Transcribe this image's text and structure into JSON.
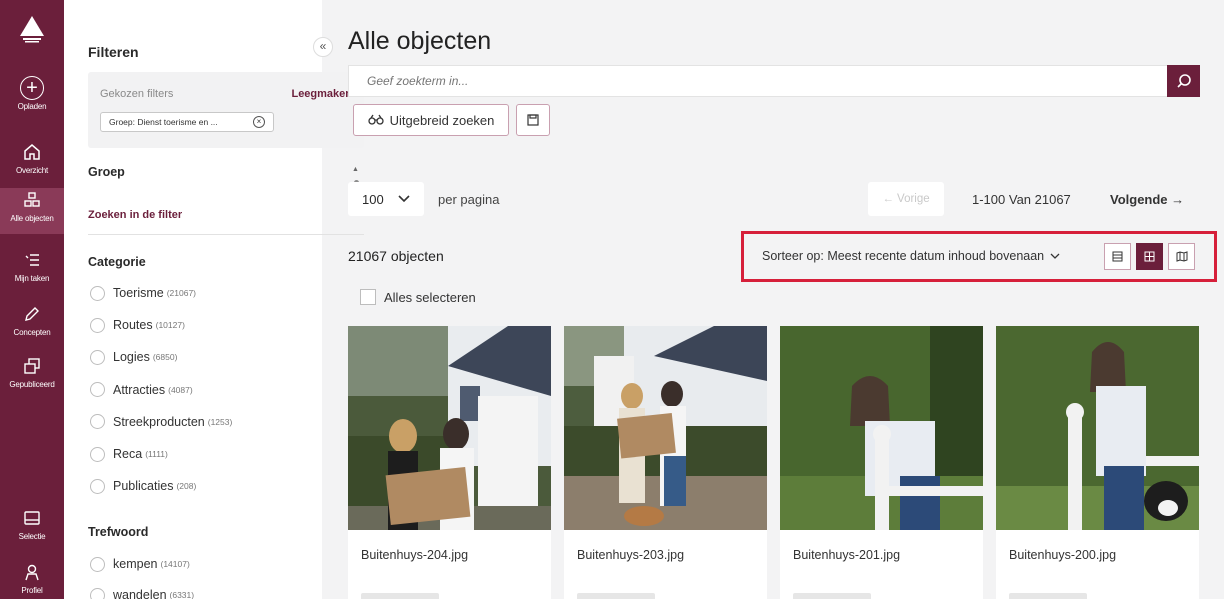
{
  "rail": {
    "items": [
      {
        "label": "Opladen",
        "icon": "plus-circle-icon"
      },
      {
        "label": "Overzicht",
        "icon": "home-icon"
      },
      {
        "label": "Alle objecten",
        "icon": "grid-icon"
      },
      {
        "label": "Mijn taken",
        "icon": "checklist-icon"
      },
      {
        "label": "Concepten",
        "icon": "pencil-icon"
      },
      {
        "label": "Gepubliceerd",
        "icon": "publish-icon"
      },
      {
        "label": "Selectie",
        "icon": "tray-icon"
      },
      {
        "label": "Profiel",
        "icon": "user-icon"
      }
    ]
  },
  "filters": {
    "title": "Filteren",
    "chosen_label": "Gekozen filters",
    "clear_label": "Leegmaken",
    "chip": "Groep: Dienst toerisme en ...",
    "groep_title": "Groep",
    "search_in_filter": "Zoeken in de filter",
    "categorie_title": "Categorie",
    "categories": [
      {
        "label": "Toerisme",
        "count": "(21067)"
      },
      {
        "label": "Routes",
        "count": "(10127)"
      },
      {
        "label": "Logies",
        "count": "(6850)"
      },
      {
        "label": "Attracties",
        "count": "(4087)"
      },
      {
        "label": "Streekproducten",
        "count": "(1253)"
      },
      {
        "label": "Reca",
        "count": "(1111)"
      },
      {
        "label": "Publicaties",
        "count": "(208)"
      }
    ],
    "trefwoord_title": "Trefwoord",
    "keywords": [
      {
        "label": "kempen",
        "count": "(14107)"
      },
      {
        "label": "wandelen",
        "count": "(6331)"
      }
    ]
  },
  "main": {
    "title": "Alle objecten",
    "search_placeholder": "Geef zoekterm in...",
    "advanced_label": "Uitgebreid zoeken",
    "per_page_value": "100",
    "per_page_label": "per pagina",
    "prev_label": "← Vorige",
    "range_label": "1-100 Van 21067",
    "next_label": "Volgende →",
    "count_label": "21067 objecten",
    "sort_label": "Sorteer op: Meest recente datum inhoud bovenaan",
    "select_all_label": "Alles selecteren",
    "cards": [
      {
        "filename": "Buitenhuys-204.jpg"
      },
      {
        "filename": "Buitenhuys-203.jpg"
      },
      {
        "filename": "Buitenhuys-201.jpg"
      },
      {
        "filename": "Buitenhuys-200.jpg"
      }
    ]
  },
  "colors": {
    "brand": "#6b1f3b",
    "highlight": "#d61f3a"
  }
}
